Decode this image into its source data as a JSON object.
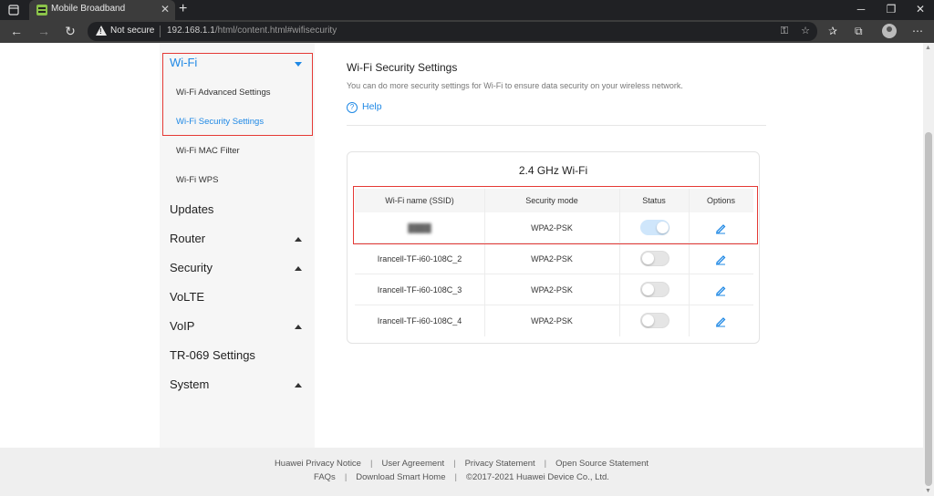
{
  "browser": {
    "tab_title": "Mobile Broadband",
    "security_label": "Not secure",
    "url_host": "192.168.1.1",
    "url_path": "/html/content.html#wifisecurity"
  },
  "sidebar": {
    "wifi": {
      "label": "Wi-Fi",
      "items": [
        "Wi-Fi Advanced Settings",
        "Wi-Fi Security Settings",
        "Wi-Fi MAC Filter",
        "Wi-Fi WPS"
      ],
      "active_item": "Wi-Fi Security Settings"
    },
    "sections": [
      "Updates",
      "Router",
      "Security",
      "VoLTE",
      "VoIP",
      "TR-069 Settings",
      "System"
    ]
  },
  "main": {
    "title": "Wi-Fi Security Settings",
    "description": "You can do more security settings for Wi-Fi to ensure data security on your wireless network.",
    "help": "Help",
    "card": {
      "title": "2.4 GHz Wi-Fi",
      "headers": [
        "Wi-Fi name (SSID)",
        "Security mode",
        "Status",
        "Options"
      ],
      "rows": [
        {
          "ssid": "████",
          "mode": "WPA2-PSK",
          "status_on": true
        },
        {
          "ssid": "Irancell-TF-i60-108C_2",
          "mode": "WPA2-PSK",
          "status_on": false
        },
        {
          "ssid": "Irancell-TF-i60-108C_3",
          "mode": "WPA2-PSK",
          "status_on": false
        },
        {
          "ssid": "Irancell-TF-i60-108C_4",
          "mode": "WPA2-PSK",
          "status_on": false
        }
      ]
    }
  },
  "footer": {
    "line1": [
      "Huawei Privacy Notice",
      "User Agreement",
      "Privacy Statement",
      "Open Source Statement"
    ],
    "line2": [
      "FAQs",
      "Download Smart Home",
      "©2017-2021 Huawei Device Co., Ltd."
    ]
  },
  "colors": {
    "accent": "#1e88e5",
    "highlight": "#e53935",
    "toggle_on": "#cfe6fb"
  }
}
